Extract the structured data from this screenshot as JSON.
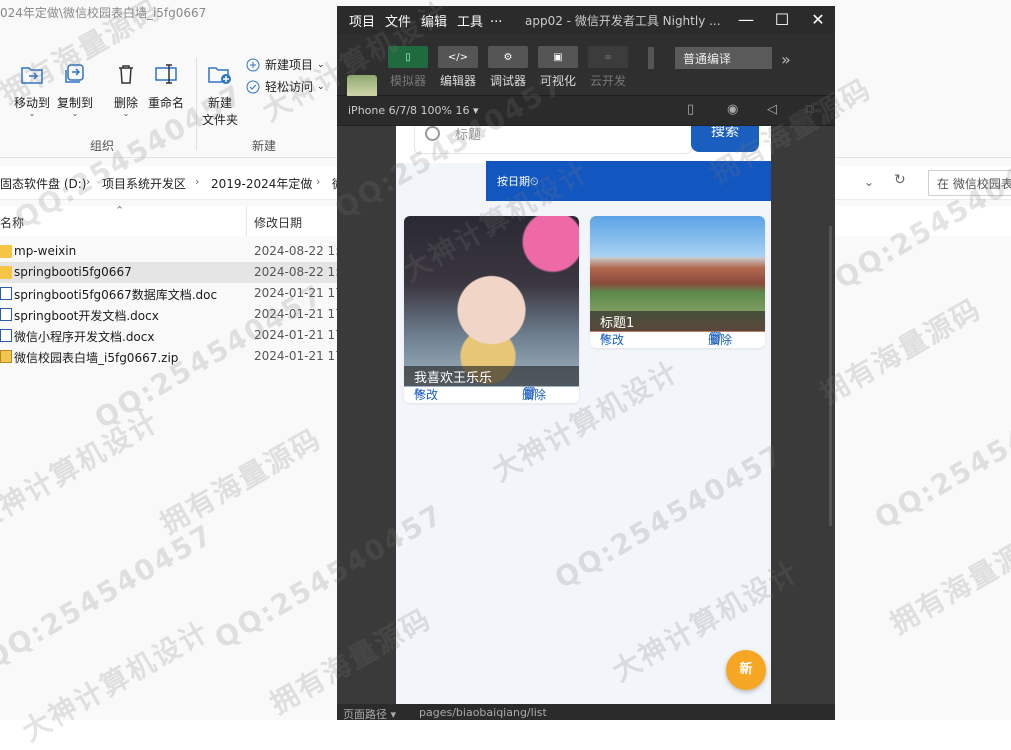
{
  "explorer": {
    "title": "024年定做\\微信校园表白墙_i5fg0667",
    "ribbon": {
      "move_to": "移动到",
      "copy_to": "复制到",
      "delete": "删除",
      "rename": "重命名",
      "new_folder": "新建\n文件夹",
      "new_folder_l1": "新建",
      "new_folder_l2": "文件夹",
      "new_item": "新建项目",
      "easy_access": "轻松访问",
      "group_organize": "组织",
      "group_new": "新建"
    },
    "breadcrumb": [
      "固态软件盘 (D:)",
      "项目系统开发区",
      "2019-2024年定做",
      "微"
    ],
    "search_placeholder": "在 微信校园表",
    "columns": {
      "name": "名称",
      "date": "修改日期"
    },
    "files": [
      {
        "name": "mp-weixin",
        "date": "2024-08-22 1:",
        "type": "folder"
      },
      {
        "name": "springbooti5fg0667",
        "date": "2024-08-22 1:",
        "type": "folder"
      },
      {
        "name": "springbooti5fg0667数据库文档.doc",
        "date": "2024-01-21 17",
        "type": "doc"
      },
      {
        "name": "springboot开发文档.docx",
        "date": "2024-01-21 17",
        "type": "doc"
      },
      {
        "name": "微信小程序开发文档.docx",
        "date": "2024-01-21 17",
        "type": "doc"
      },
      {
        "name": "微信校园表白墙_i5fg0667.zip",
        "date": "2024-01-21 17",
        "type": "zip"
      }
    ]
  },
  "devtools": {
    "menu": [
      "项目",
      "文件",
      "编辑",
      "工具",
      "..."
    ],
    "app_title": "app02 - 微信开发者工具 Nightly ...",
    "toolbar": [
      {
        "label": "模拟器",
        "icon": "simulator-icon"
      },
      {
        "label": "编辑器",
        "icon": "code-icon"
      },
      {
        "label": "调试器",
        "icon": "debug-icon"
      },
      {
        "label": "可视化",
        "icon": "layout-icon"
      },
      {
        "label": "云开发",
        "icon": "cloud-icon"
      }
    ],
    "compile_mode": "普通编译",
    "device": "iPhone 6/7/8 100% 16 ▾",
    "page_path_label": "页面路径 ▾",
    "page_path": "pages/biaobaiqiang/list"
  },
  "phone": {
    "search_placeholder": "标题",
    "search_button": "搜索",
    "sort_label": "按日期⏲",
    "cards": [
      {
        "title": "我喜欢王乐乐",
        "edit": "修改",
        "delete": "删除"
      },
      {
        "title": "标题1",
        "edit": "修改",
        "delete": "删除"
      }
    ],
    "fab_label": "新"
  },
  "watermarks": [
    "大神计算机设计",
    "拥有海量源码",
    "QQ:254540457"
  ]
}
